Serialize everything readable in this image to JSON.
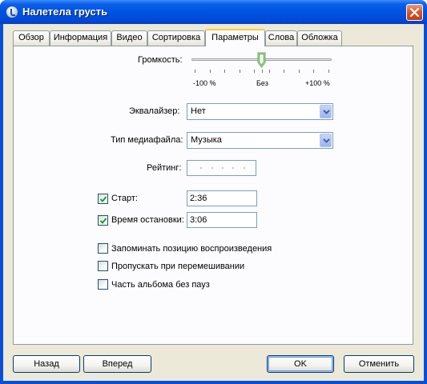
{
  "window": {
    "title": "Налетела грусть",
    "close_icon": "close-icon"
  },
  "tabs": [
    {
      "label": "Обзор"
    },
    {
      "label": "Информация"
    },
    {
      "label": "Видео"
    },
    {
      "label": "Сортировка"
    },
    {
      "label": "Параметры",
      "active": true
    },
    {
      "label": "Слова"
    },
    {
      "label": "Обложка"
    }
  ],
  "volume": {
    "label": "Громкость:",
    "min_label": "-100 %",
    "mid_label": "Без",
    "max_label": "+100 %",
    "value_percent": 0
  },
  "equalizer": {
    "label": "Эквалайзер:",
    "value": "Нет"
  },
  "media_type": {
    "label": "Тип медиафайла:",
    "value": "Музыка"
  },
  "rating": {
    "label": "Рейтинг:",
    "stars": 0,
    "max_stars": 5
  },
  "start": {
    "label": "Старт:",
    "checked": true,
    "value": "2:36"
  },
  "stop": {
    "label": "Время остановки:",
    "checked": true,
    "value": "3:06"
  },
  "options": [
    {
      "label": "Запоминать позицию воспроизведения",
      "checked": false
    },
    {
      "label": "Пропускать при перемешивании",
      "checked": false
    },
    {
      "label": "Часть альбома без пауз",
      "checked": false
    }
  ],
  "buttons": {
    "back": "Назад",
    "forward": "Вперед",
    "ok": "OK",
    "cancel": "Отменить"
  },
  "colors": {
    "titlebar": "#0053e0",
    "face": "#ece9d8",
    "tab_highlight": "#ffc83c",
    "check": "#21a121"
  }
}
